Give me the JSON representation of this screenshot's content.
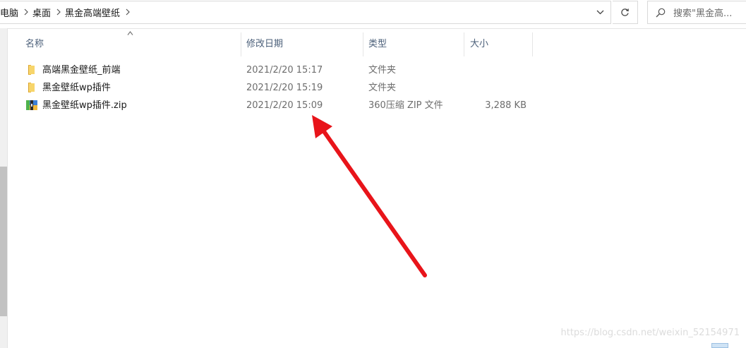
{
  "breadcrumb": {
    "items": [
      "电脑",
      "桌面",
      "黑金高端壁纸"
    ]
  },
  "search": {
    "placeholder": "搜索\"黑金高..."
  },
  "columns": {
    "name": "名称",
    "date": "修改日期",
    "type": "类型",
    "size": "大小"
  },
  "files": [
    {
      "name": "高端黑金壁纸_前端",
      "date": "2021/2/20 15:17",
      "type": "文件夹",
      "size": "",
      "icon": "folder-icon"
    },
    {
      "name": "黑金壁纸wp插件",
      "date": "2021/2/20 15:19",
      "type": "文件夹",
      "size": "",
      "icon": "folder-icon"
    },
    {
      "name": "黑金壁纸wp插件.zip",
      "date": "2021/2/20 15:09",
      "type": "360压缩 ZIP 文件",
      "size": "3,288 KB",
      "icon": "zip-archive-icon"
    }
  ],
  "watermark": "https://blog.csdn.net/weixin_52154971",
  "colors": {
    "header_text": "#4c607a",
    "folder": "#f3c64b",
    "annotation_arrow": "#e8141a"
  }
}
